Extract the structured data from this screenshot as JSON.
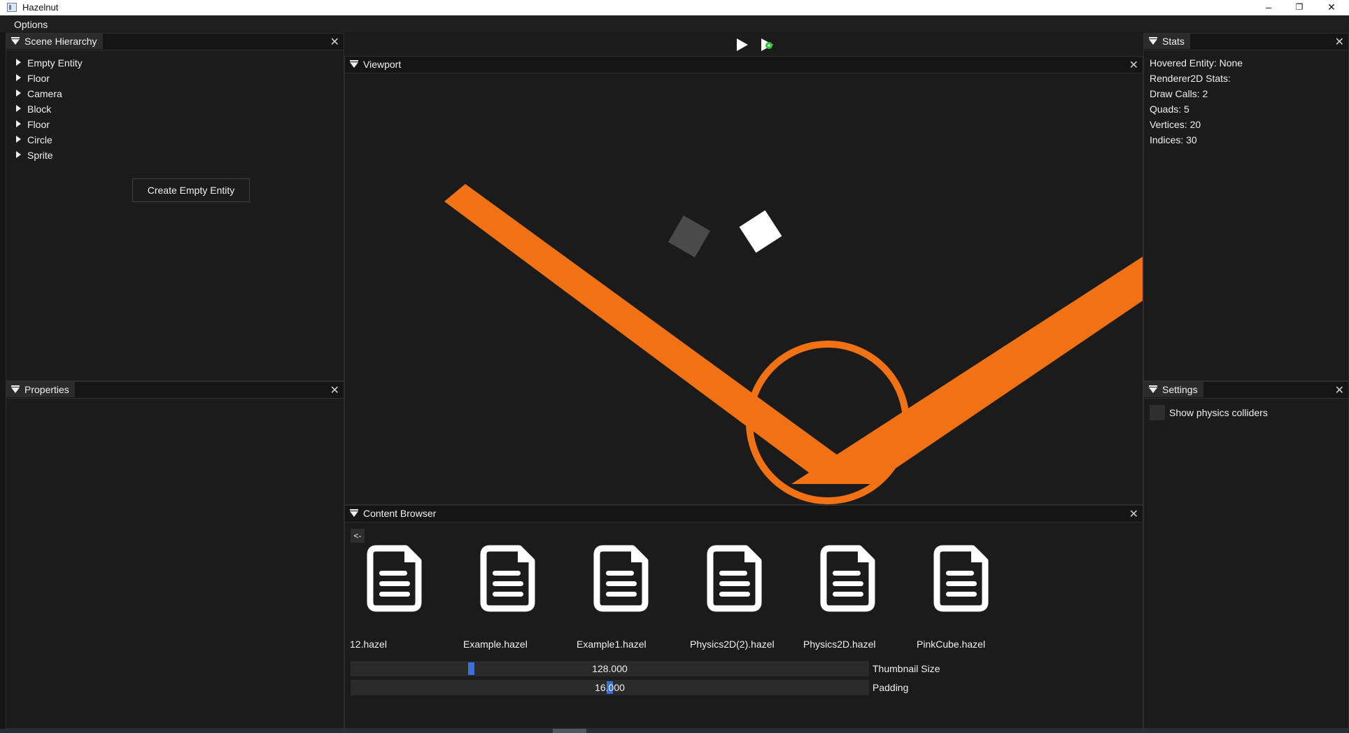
{
  "window": {
    "title": "Hazelnut",
    "minimize": "–",
    "maximize": "❐",
    "close": "✕"
  },
  "menu": {
    "items": [
      "Options"
    ]
  },
  "toolbar": {
    "play_icon": "play-icon",
    "simulate_icon": "simulate-icon"
  },
  "scene_hierarchy": {
    "title": "Scene Hierarchy",
    "close": "✕",
    "entities": [
      "Empty Entity",
      "Floor",
      "Camera",
      "Block",
      "Floor",
      "Circle",
      "Sprite"
    ],
    "context_menu_item": "Create Empty Entity"
  },
  "properties": {
    "title": "Properties",
    "close": "✕"
  },
  "viewport": {
    "title": "Viewport",
    "close": "✕",
    "colors": {
      "orange": "#f07214",
      "gray_square": "#4a4a4a",
      "white_square": "#ffffff",
      "background": "#1b1b1b"
    }
  },
  "content_browser": {
    "title": "Content Browser",
    "close": "✕",
    "back_button": "<-",
    "files": [
      "12.hazel",
      "Example.hazel",
      "Example1.hazel",
      "Physics2D(2).hazel",
      "Physics2D.hazel",
      "PinkCube.hazel"
    ],
    "thumbnail_size": {
      "value": "128.000",
      "label": "Thumbnail Size",
      "fraction": 0.23
    },
    "padding": {
      "value": "16.000",
      "label": "Padding",
      "fraction": 0.5
    }
  },
  "stats": {
    "title": "Stats",
    "close": "✕",
    "lines": [
      "Hovered Entity: None",
      "Renderer2D Stats:",
      "Draw Calls: 2",
      "Quads: 5",
      "Vertices: 20",
      "Indices: 30"
    ]
  },
  "settings": {
    "title": "Settings",
    "close": "✕",
    "show_colliders_label": "Show physics colliders",
    "show_colliders_checked": false
  },
  "accent_color": "#3d6fdb"
}
